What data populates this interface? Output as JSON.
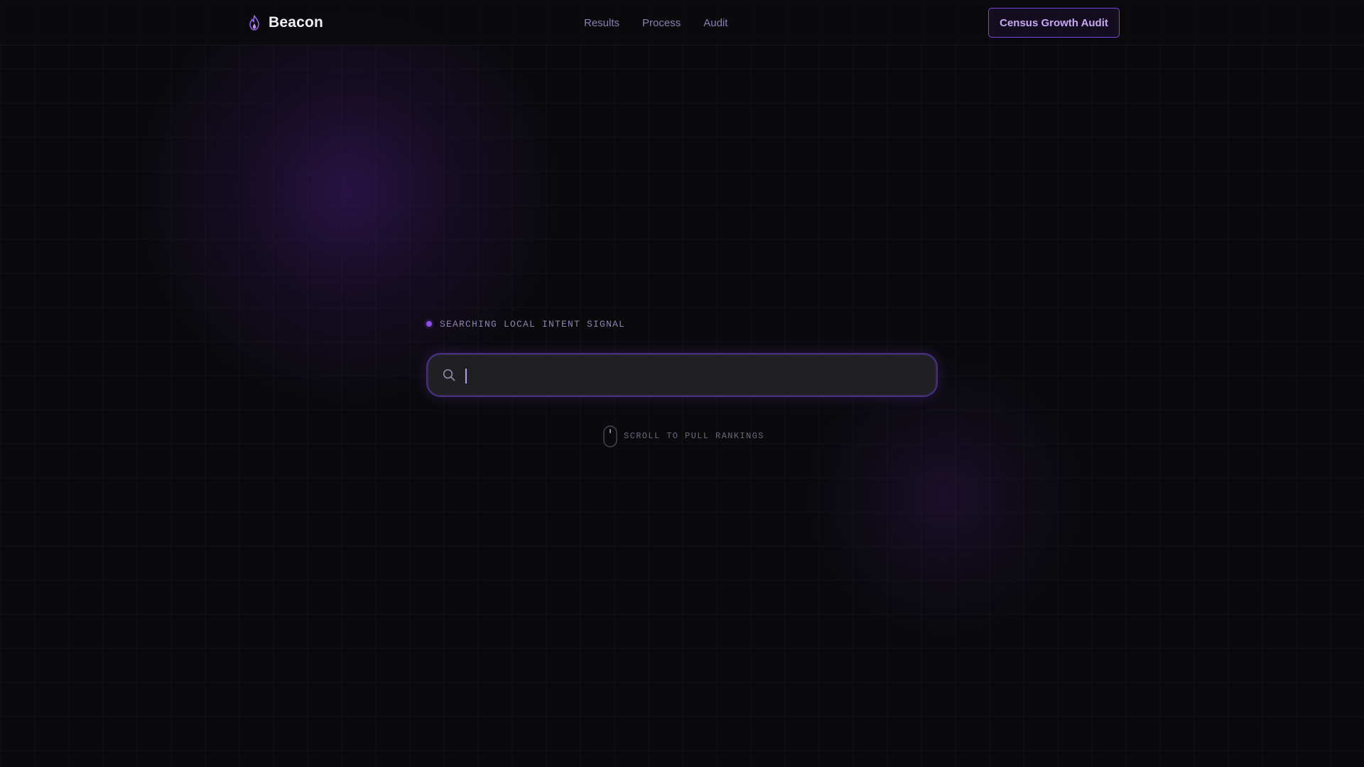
{
  "header": {
    "brand_name": "Beacon",
    "brand_icon": "flame-icon",
    "nav": [
      {
        "label": "Results"
      },
      {
        "label": "Process"
      },
      {
        "label": "Audit"
      }
    ],
    "cta_label": "Census Growth Audit"
  },
  "hero": {
    "status_text": "SEARCHING LOCAL INTENT SIGNAL",
    "search": {
      "value": "",
      "icon": "search-icon"
    },
    "scroll_hint": "SCROLL TO PULL RANKINGS",
    "scroll_icon": "mouse-icon"
  },
  "colors": {
    "background": "#0a0a0d",
    "accent": "#8a4fe6",
    "cta_text": "#c6a9f5",
    "nav_text": "#8a7fb5"
  }
}
